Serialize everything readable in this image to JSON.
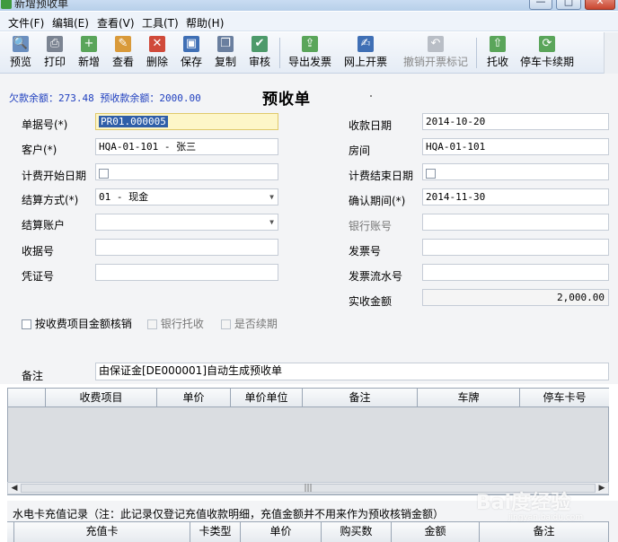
{
  "window": {
    "title": "新增预收单",
    "btn_min": "—",
    "btn_max": "□",
    "btn_close": "✕"
  },
  "menu": [
    "文件(F)",
    "编辑(E)",
    "查看(V)",
    "工具(T)",
    "帮助(H)"
  ],
  "toolbar": [
    {
      "label": "预览",
      "icon": "preview-icon"
    },
    {
      "label": "打印",
      "icon": "print-icon"
    },
    {
      "label": "新增",
      "icon": "add-icon"
    },
    {
      "label": "查看",
      "icon": "view-icon"
    },
    {
      "label": "删除",
      "icon": "delete-icon"
    },
    {
      "label": "保存",
      "icon": "save-icon"
    },
    {
      "label": "复制",
      "icon": "copy-icon"
    },
    {
      "label": "审核",
      "icon": "audit-icon"
    },
    {
      "label": "导出发票",
      "icon": "export-invoice-icon"
    },
    {
      "label": "网上开票",
      "icon": "online-invoice-icon"
    },
    {
      "label": "撤销开票标记",
      "icon": "undo-icon"
    },
    {
      "label": "托收",
      "icon": "collect-icon"
    },
    {
      "label": "停车卡续期",
      "icon": "renew-icon"
    }
  ],
  "balance": "欠款余额：273.48 预收款余额：2000.00",
  "form_title": "预收单",
  "labels": {
    "doc_no": "单据号(*)",
    "customer": "客户(*)",
    "fee_start": "计费开始日期",
    "settle": "结算方式(*)",
    "settle_acct": "结算账户",
    "receipt_no": "收据号",
    "voucher_no": "凭证号",
    "recv_date": "收款日期",
    "room": "房间",
    "fee_end": "计费结束日期",
    "confirm_period": "确认期间(*)",
    "bank_acct": "银行账号",
    "invoice_no": "发票号",
    "invoice_serial": "发票流水号",
    "actual_amount": "实收金额",
    "remark": "备注"
  },
  "values": {
    "doc_no": "PR01.000005",
    "customer": "HQA-01-101 - 张三",
    "settle": "01 - 现金",
    "recv_date": "2014-10-20",
    "room": "HQA-01-101",
    "confirm_period": "2014-11-30",
    "actual_amount": "2,000.00",
    "remark": "由保证金[DE000001]自动生成预收单"
  },
  "checkboxes": {
    "by_item": "按收费项目金额核销",
    "bank_collect": "银行托收",
    "renew": "是否续期"
  },
  "grid_headers": [
    "收费项目",
    "单价",
    "单价单位",
    "备注",
    "车牌",
    "停车卡号"
  ],
  "section_caption": "水电卡充值记录（注：此记录仅登记充值收款明细，充值金额并不用来作为预收核销金额）",
  "grid2_headers": [
    "充值卡",
    "卡类型",
    "单价",
    "购买数",
    "金额",
    "备注"
  ],
  "watermark": {
    "brand": "Bai度经验",
    "sub": "jingyan.baidu.com"
  },
  "colors": {
    "balance_blue": "#1f3fbf",
    "selection": "#2f5ea8",
    "panel": "#f3f4f6"
  }
}
